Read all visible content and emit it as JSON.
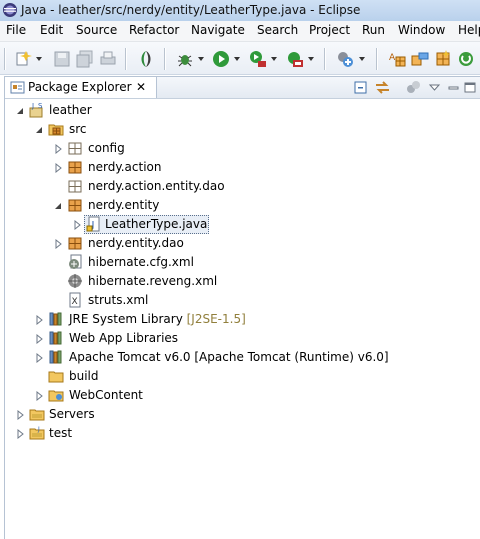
{
  "window": {
    "title": "Java - leather/src/nerdy/entity/LeatherType.java - Eclipse"
  },
  "menu": [
    "File",
    "Edit",
    "Source",
    "Refactor",
    "Navigate",
    "Search",
    "Project",
    "Run",
    "Window",
    "Help"
  ],
  "toolbar": {
    "icons": [
      "new-wizard-icon",
      "save-icon",
      "save-all-icon",
      "print-icon",
      "perspective-icon",
      "debug-icon",
      "run-icon",
      "run-coverage-icon",
      "external-tools-icon",
      "new-java-project-icon",
      "new-package-icon",
      "new-class-icon",
      "open-type-icon",
      "web-icon"
    ]
  },
  "view": {
    "tab_label": "Package Explorer",
    "close_glyph": "✕"
  },
  "tree": {
    "project": "leather",
    "src": "src",
    "config": "config",
    "pkg_action": "nerdy.action",
    "pkg_action_entity_dao": "nerdy.action.entity.dao",
    "pkg_entity": "nerdy.entity",
    "file_leathertype": "LeatherType.java",
    "pkg_entity_dao": "nerdy.entity.dao",
    "file_hib_cfg": "hibernate.cfg.xml",
    "file_hib_reveng": "hibernate.reveng.xml",
    "file_struts": "struts.xml",
    "jre_label": "JRE System Library",
    "jre_decoration": "[J2SE-1.5]",
    "webapp_libs": "Web App Libraries",
    "tomcat": "Apache Tomcat v6.0 [Apache Tomcat (Runtime) v6.0]",
    "build": "build",
    "webcontent": "WebContent",
    "servers": "Servers",
    "test": "test"
  },
  "colors": {
    "accent": "#3f7fc8",
    "decoration": "#917f3c",
    "package": "#c7842a"
  }
}
